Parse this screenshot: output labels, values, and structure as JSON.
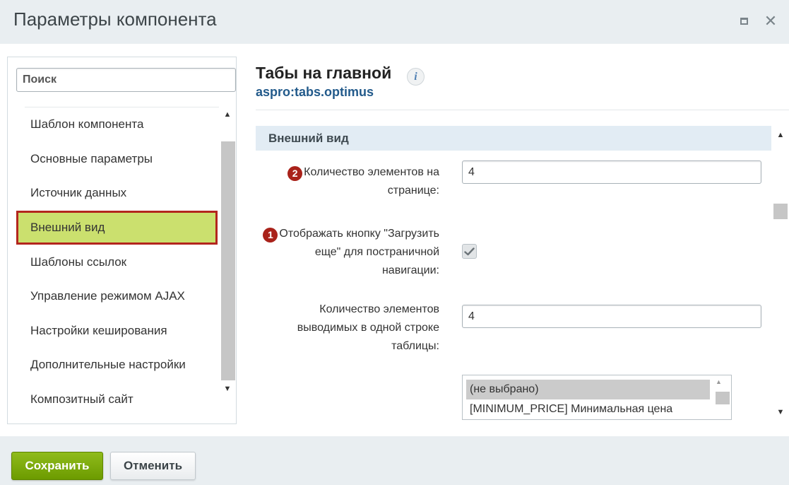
{
  "window": {
    "title": "Параметры компонента"
  },
  "search": {
    "placeholder": "Поиск",
    "value": ""
  },
  "sidebar": {
    "items": [
      {
        "label": "Шаблон компонента",
        "active": false
      },
      {
        "label": "Основные параметры",
        "active": false
      },
      {
        "label": "Источник данных",
        "active": false
      },
      {
        "label": "Внешний вид",
        "active": true
      },
      {
        "label": "Шаблоны ссылок",
        "active": false
      },
      {
        "label": "Управление режимом AJAX",
        "active": false
      },
      {
        "label": "Настройки кеширования",
        "active": false
      },
      {
        "label": "Дополнительные настройки",
        "active": false
      },
      {
        "label": "Композитный сайт",
        "active": false
      }
    ]
  },
  "component": {
    "title": "Табы на главной",
    "code": "aspro:tabs.optimus",
    "info_icon": "info-icon"
  },
  "section": {
    "title": "Внешний вид"
  },
  "fields": {
    "page_count": {
      "badge": "2",
      "label_line1": "Количество элементов на",
      "label_line2": "странице:",
      "value": "4"
    },
    "load_more": {
      "badge": "1",
      "label_line1": "Отображать кнопку \"Загрузить",
      "label_line2": "еще\" для постраничной",
      "label_line3": "навигации:",
      "checked": true
    },
    "row_count": {
      "label_line1": "Количество элементов",
      "label_line2": "выводимых в одной строке",
      "label_line3": "таблицы:",
      "value": "4"
    },
    "price_list": {
      "options": [
        "(не выбрано)",
        "[MINIMUM_PRICE] Минимальная цена"
      ],
      "selected": "(не выбрано)"
    }
  },
  "footer": {
    "save_label": "Сохранить",
    "cancel_label": "Отменить"
  },
  "colors": {
    "active_item_bg": "#cbe06e",
    "active_item_border": "#b3261e",
    "badge": "#a9221a",
    "link": "#225a8b",
    "save_button": "#7aa80d",
    "section_header_bg": "#e2ecf4"
  }
}
